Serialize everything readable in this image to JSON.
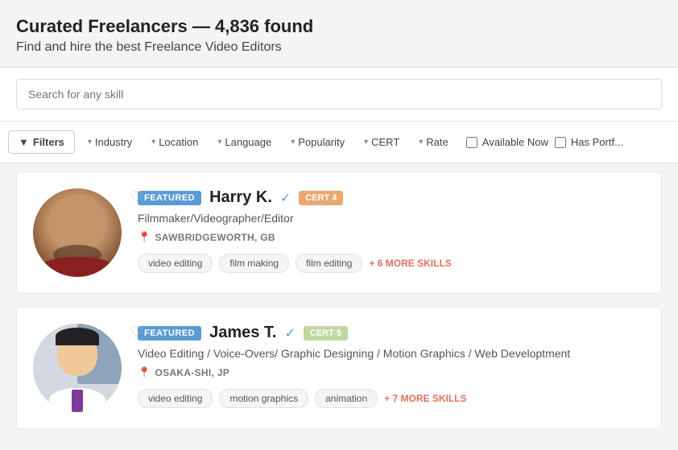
{
  "header": {
    "title": "Curated Freelancers — 4,836 found",
    "subtitle": "Find and hire the best Freelance Video Editors"
  },
  "search": {
    "placeholder": "Search for any skill"
  },
  "filters": {
    "filters_label": "Filters",
    "industry_label": "Industry",
    "location_label": "Location",
    "language_label": "Language",
    "popularity_label": "Popularity",
    "cert_label": "CERT",
    "rate_label": "Rate",
    "available_now_label": "Available Now",
    "has_portfolio_label": "Has Portf..."
  },
  "freelancers": [
    {
      "featured_badge": "FEATURED",
      "name": "Harry K.",
      "cert": "CERT 4",
      "title": "Filmmaker/Videographer/Editor",
      "location": "SAWBRIDGEWORTH, GB",
      "skills": [
        "video editing",
        "film making",
        "film editing"
      ],
      "more_skills": "+ 6 MORE SKILLS"
    },
    {
      "featured_badge": "FEATURED",
      "name": "James T.",
      "cert": "CERT 5",
      "title": "Video Editing / Voice-Overs/ Graphic Designing / Motion Graphics / Web Developtment",
      "location": "OSAKA-SHI, JP",
      "skills": [
        "video editing",
        "motion graphics",
        "animation"
      ],
      "more_skills": "+ 7 MORE SKILLS"
    }
  ]
}
